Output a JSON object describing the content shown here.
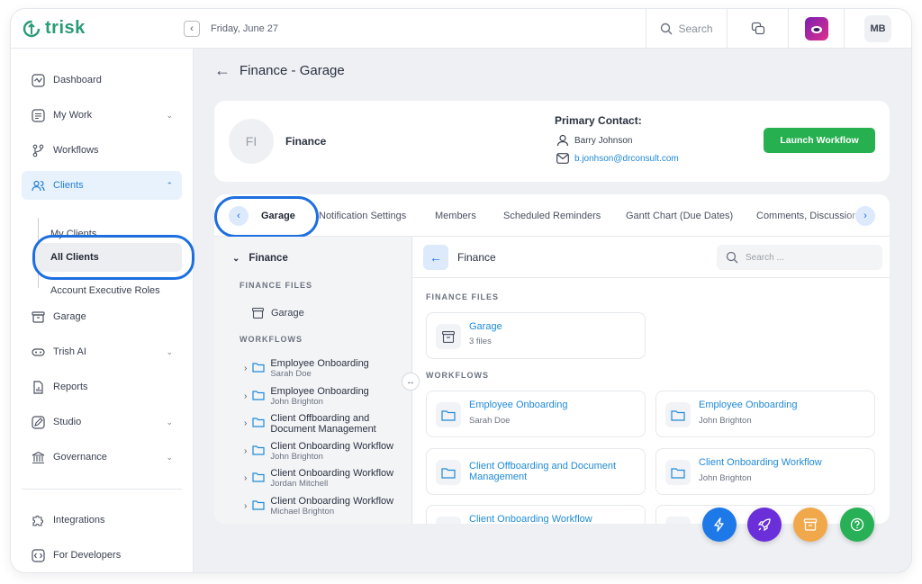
{
  "app": {
    "brand": "trisk",
    "brand_color": "#2a9b74",
    "accent": "#1d6fe0"
  },
  "topbar": {
    "date": "Friday, June 27",
    "search_label": "Search",
    "user_initials": "MB"
  },
  "sidebar": {
    "items": [
      {
        "label": "Dashboard",
        "icon": "dashboard-icon"
      },
      {
        "label": "My Work",
        "icon": "my-work-icon"
      },
      {
        "label": "Workflows",
        "icon": "workflows-icon"
      },
      {
        "label": "Clients",
        "icon": "clients-icon"
      },
      {
        "label": "Garage",
        "icon": "archive-icon"
      },
      {
        "label": "Trish AI",
        "icon": "ai-icon"
      },
      {
        "label": "Reports",
        "icon": "reports-icon"
      },
      {
        "label": "Studio",
        "icon": "studio-icon"
      },
      {
        "label": "Governance",
        "icon": "governance-icon"
      },
      {
        "label": "Integrations",
        "icon": "integrations-icon"
      },
      {
        "label": "For Developers",
        "icon": "developers-icon"
      }
    ],
    "sub_items": [
      "My Clients",
      "All Clients",
      "Account Executive Roles"
    ]
  },
  "page": {
    "title": "Finance - Garage",
    "client_initials": "FI",
    "client_name": "Finance",
    "primary_contact_label": "Primary Contact:",
    "contact_name": "Barry Johnson",
    "contact_email": "b.jonhson@drconsult.com",
    "launch_label": "Launch Workflow"
  },
  "tabs": [
    "Garage",
    "Notification Settings",
    "Members",
    "Scheduled Reminders",
    "Gantt Chart (Due Dates)",
    "Comments, Discussion"
  ],
  "tree": {
    "root": "Finance",
    "files_label": "FINANCE FILES",
    "file_leaf": "Garage",
    "workflows_label": "WORKFLOWS",
    "workflows": [
      {
        "title": "Employee Onboarding",
        "sub": "Sarah Doe"
      },
      {
        "title": "Employee Onboarding",
        "sub": "John Brighton"
      },
      {
        "title": "Client Offboarding and Document Management",
        "sub": ""
      },
      {
        "title": "Client Onboarding Workflow",
        "sub": "John Brighton"
      },
      {
        "title": "Client Onboarding Workflow",
        "sub": "Jordan Mitchell"
      },
      {
        "title": "Client Onboarding Workflow",
        "sub": "Michael Brighton"
      }
    ]
  },
  "browser": {
    "title": "Finance",
    "search_placeholder": "Search ...",
    "files_label": "FINANCE FILES",
    "workflows_label": "WORKFLOWS",
    "files": [
      {
        "name": "Garage",
        "sub": "3 files"
      }
    ],
    "workflows": [
      {
        "name": "Employee Onboarding",
        "sub": "Sarah Doe"
      },
      {
        "name": "Employee Onboarding",
        "sub": "John Brighton"
      },
      {
        "name": "Client Offboarding and Document Management",
        "sub": ""
      },
      {
        "name": "Client Onboarding Workflow",
        "sub": "John Brighton"
      },
      {
        "name": "Client Onboarding Workflow",
        "sub": ""
      }
    ]
  }
}
